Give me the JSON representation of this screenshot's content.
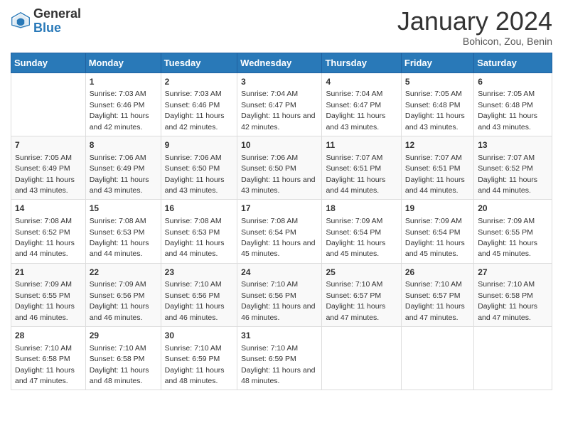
{
  "header": {
    "logo_general": "General",
    "logo_blue": "Blue",
    "month_title": "January 2024",
    "location": "Bohicon, Zou, Benin"
  },
  "days_of_week": [
    "Sunday",
    "Monday",
    "Tuesday",
    "Wednesday",
    "Thursday",
    "Friday",
    "Saturday"
  ],
  "weeks": [
    [
      {
        "day": "",
        "sunrise": "",
        "sunset": "",
        "daylight": ""
      },
      {
        "day": "1",
        "sunrise": "Sunrise: 7:03 AM",
        "sunset": "Sunset: 6:46 PM",
        "daylight": "Daylight: 11 hours and 42 minutes."
      },
      {
        "day": "2",
        "sunrise": "Sunrise: 7:03 AM",
        "sunset": "Sunset: 6:46 PM",
        "daylight": "Daylight: 11 hours and 42 minutes."
      },
      {
        "day": "3",
        "sunrise": "Sunrise: 7:04 AM",
        "sunset": "Sunset: 6:47 PM",
        "daylight": "Daylight: 11 hours and 42 minutes."
      },
      {
        "day": "4",
        "sunrise": "Sunrise: 7:04 AM",
        "sunset": "Sunset: 6:47 PM",
        "daylight": "Daylight: 11 hours and 43 minutes."
      },
      {
        "day": "5",
        "sunrise": "Sunrise: 7:05 AM",
        "sunset": "Sunset: 6:48 PM",
        "daylight": "Daylight: 11 hours and 43 minutes."
      },
      {
        "day": "6",
        "sunrise": "Sunrise: 7:05 AM",
        "sunset": "Sunset: 6:48 PM",
        "daylight": "Daylight: 11 hours and 43 minutes."
      }
    ],
    [
      {
        "day": "7",
        "sunrise": "Sunrise: 7:05 AM",
        "sunset": "Sunset: 6:49 PM",
        "daylight": "Daylight: 11 hours and 43 minutes."
      },
      {
        "day": "8",
        "sunrise": "Sunrise: 7:06 AM",
        "sunset": "Sunset: 6:49 PM",
        "daylight": "Daylight: 11 hours and 43 minutes."
      },
      {
        "day": "9",
        "sunrise": "Sunrise: 7:06 AM",
        "sunset": "Sunset: 6:50 PM",
        "daylight": "Daylight: 11 hours and 43 minutes."
      },
      {
        "day": "10",
        "sunrise": "Sunrise: 7:06 AM",
        "sunset": "Sunset: 6:50 PM",
        "daylight": "Daylight: 11 hours and 43 minutes."
      },
      {
        "day": "11",
        "sunrise": "Sunrise: 7:07 AM",
        "sunset": "Sunset: 6:51 PM",
        "daylight": "Daylight: 11 hours and 44 minutes."
      },
      {
        "day": "12",
        "sunrise": "Sunrise: 7:07 AM",
        "sunset": "Sunset: 6:51 PM",
        "daylight": "Daylight: 11 hours and 44 minutes."
      },
      {
        "day": "13",
        "sunrise": "Sunrise: 7:07 AM",
        "sunset": "Sunset: 6:52 PM",
        "daylight": "Daylight: 11 hours and 44 minutes."
      }
    ],
    [
      {
        "day": "14",
        "sunrise": "Sunrise: 7:08 AM",
        "sunset": "Sunset: 6:52 PM",
        "daylight": "Daylight: 11 hours and 44 minutes."
      },
      {
        "day": "15",
        "sunrise": "Sunrise: 7:08 AM",
        "sunset": "Sunset: 6:53 PM",
        "daylight": "Daylight: 11 hours and 44 minutes."
      },
      {
        "day": "16",
        "sunrise": "Sunrise: 7:08 AM",
        "sunset": "Sunset: 6:53 PM",
        "daylight": "Daylight: 11 hours and 44 minutes."
      },
      {
        "day": "17",
        "sunrise": "Sunrise: 7:08 AM",
        "sunset": "Sunset: 6:54 PM",
        "daylight": "Daylight: 11 hours and 45 minutes."
      },
      {
        "day": "18",
        "sunrise": "Sunrise: 7:09 AM",
        "sunset": "Sunset: 6:54 PM",
        "daylight": "Daylight: 11 hours and 45 minutes."
      },
      {
        "day": "19",
        "sunrise": "Sunrise: 7:09 AM",
        "sunset": "Sunset: 6:54 PM",
        "daylight": "Daylight: 11 hours and 45 minutes."
      },
      {
        "day": "20",
        "sunrise": "Sunrise: 7:09 AM",
        "sunset": "Sunset: 6:55 PM",
        "daylight": "Daylight: 11 hours and 45 minutes."
      }
    ],
    [
      {
        "day": "21",
        "sunrise": "Sunrise: 7:09 AM",
        "sunset": "Sunset: 6:55 PM",
        "daylight": "Daylight: 11 hours and 46 minutes."
      },
      {
        "day": "22",
        "sunrise": "Sunrise: 7:09 AM",
        "sunset": "Sunset: 6:56 PM",
        "daylight": "Daylight: 11 hours and 46 minutes."
      },
      {
        "day": "23",
        "sunrise": "Sunrise: 7:10 AM",
        "sunset": "Sunset: 6:56 PM",
        "daylight": "Daylight: 11 hours and 46 minutes."
      },
      {
        "day": "24",
        "sunrise": "Sunrise: 7:10 AM",
        "sunset": "Sunset: 6:56 PM",
        "daylight": "Daylight: 11 hours and 46 minutes."
      },
      {
        "day": "25",
        "sunrise": "Sunrise: 7:10 AM",
        "sunset": "Sunset: 6:57 PM",
        "daylight": "Daylight: 11 hours and 47 minutes."
      },
      {
        "day": "26",
        "sunrise": "Sunrise: 7:10 AM",
        "sunset": "Sunset: 6:57 PM",
        "daylight": "Daylight: 11 hours and 47 minutes."
      },
      {
        "day": "27",
        "sunrise": "Sunrise: 7:10 AM",
        "sunset": "Sunset: 6:58 PM",
        "daylight": "Daylight: 11 hours and 47 minutes."
      }
    ],
    [
      {
        "day": "28",
        "sunrise": "Sunrise: 7:10 AM",
        "sunset": "Sunset: 6:58 PM",
        "daylight": "Daylight: 11 hours and 47 minutes."
      },
      {
        "day": "29",
        "sunrise": "Sunrise: 7:10 AM",
        "sunset": "Sunset: 6:58 PM",
        "daylight": "Daylight: 11 hours and 48 minutes."
      },
      {
        "day": "30",
        "sunrise": "Sunrise: 7:10 AM",
        "sunset": "Sunset: 6:59 PM",
        "daylight": "Daylight: 11 hours and 48 minutes."
      },
      {
        "day": "31",
        "sunrise": "Sunrise: 7:10 AM",
        "sunset": "Sunset: 6:59 PM",
        "daylight": "Daylight: 11 hours and 48 minutes."
      },
      {
        "day": "",
        "sunrise": "",
        "sunset": "",
        "daylight": ""
      },
      {
        "day": "",
        "sunrise": "",
        "sunset": "",
        "daylight": ""
      },
      {
        "day": "",
        "sunrise": "",
        "sunset": "",
        "daylight": ""
      }
    ]
  ]
}
